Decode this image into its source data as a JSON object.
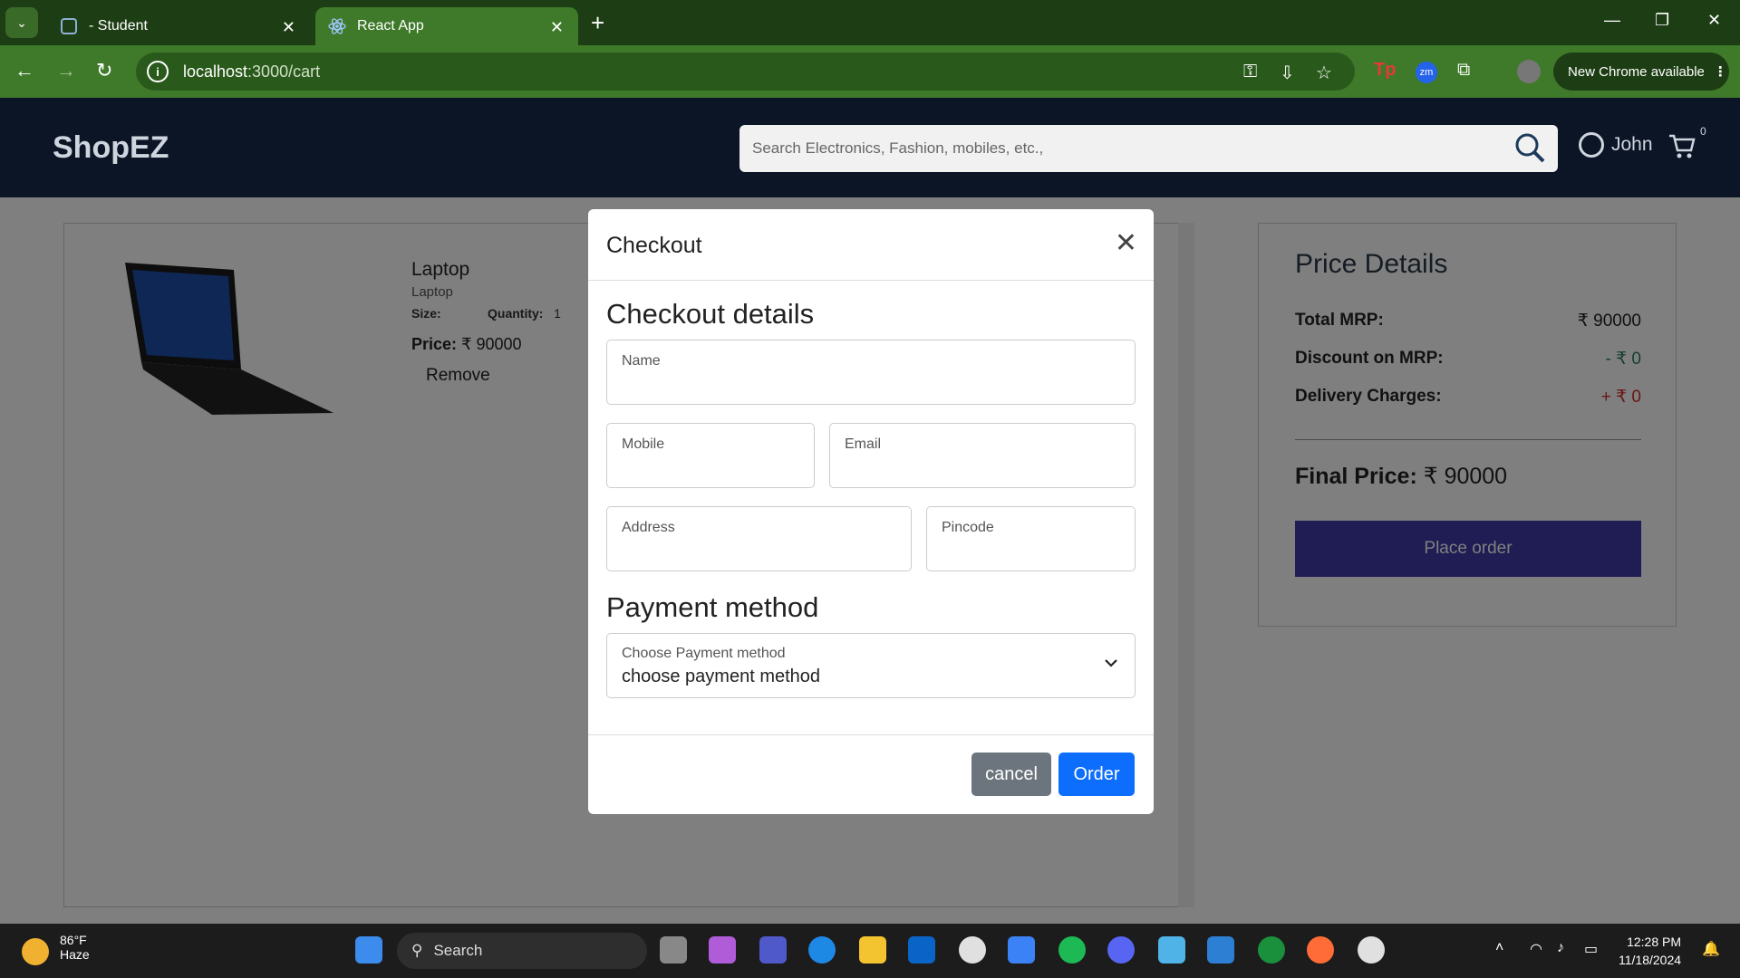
{
  "browser": {
    "tabs": [
      {
        "label": "- Student"
      },
      {
        "label": "React App"
      }
    ],
    "url_host": "localhost",
    "url_path": ":3000/cart",
    "new_chrome_label": "New Chrome available"
  },
  "app": {
    "logo": "ShopEZ",
    "search_placeholder": "Search Electronics, Fashion, mobiles, etc.,",
    "user_name": "John",
    "cart_count": "0"
  },
  "cart_item": {
    "title": "Laptop",
    "subtitle": "Laptop",
    "size_label": "Size:",
    "quantity_label": "Quantity:",
    "quantity": "1",
    "price_label": "Price:",
    "price": "₹ 90000",
    "remove_label": "Remove"
  },
  "price_details": {
    "heading": "Price Details",
    "total_mrp_label": "Total MRP:",
    "total_mrp": "₹ 90000",
    "discount_label": "Discount on MRP:",
    "discount": "- ₹ 0",
    "delivery_label": "Delivery Charges:",
    "delivery": "+ ₹ 0",
    "final_label": "Final Price:",
    "final_value": "₹ 90000",
    "place_order_label": "Place order",
    "colors": {
      "discount": "#2e7d5b",
      "delivery": "#d32f2f",
      "button": "#3e3aa8"
    }
  },
  "modal": {
    "title": "Checkout",
    "details_heading": "Checkout details",
    "fields": {
      "name": "Name",
      "mobile": "Mobile",
      "email": "Email",
      "address": "Address",
      "pincode": "Pincode"
    },
    "payment_heading": "Payment method",
    "payment_label": "Choose Payment method",
    "payment_value": "choose payment method",
    "cancel_label": "cancel",
    "order_label": "Order"
  },
  "taskbar": {
    "temperature": "86°F",
    "weather": "Haze",
    "search_label": "Search",
    "time": "12:28 PM",
    "date": "11/18/2024"
  }
}
